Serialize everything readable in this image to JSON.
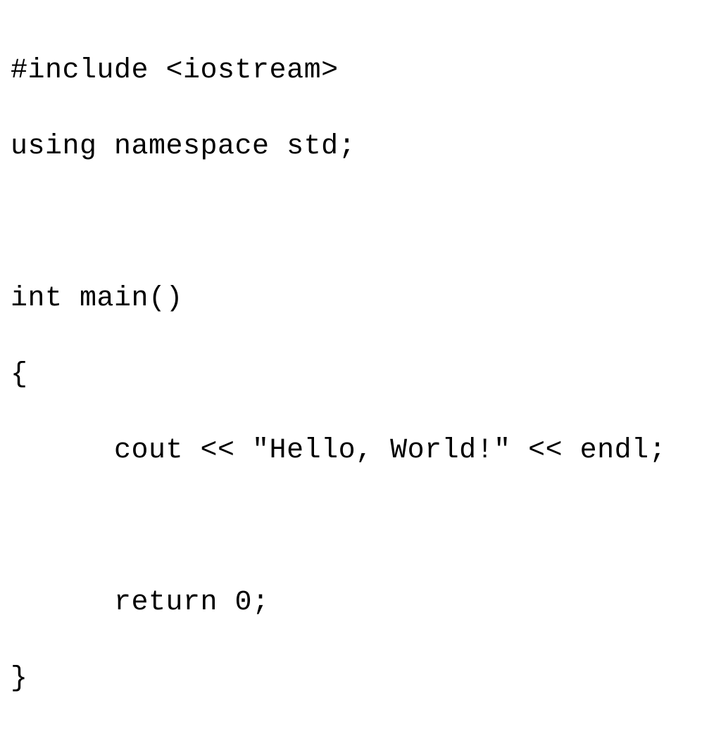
{
  "code": {
    "lines": [
      "#include <iostream>",
      "using namespace std;",
      "",
      "int main()",
      "{",
      "      cout << \"Hello, World!\" << endl;",
      "",
      "      return 0;",
      "}"
    ]
  }
}
